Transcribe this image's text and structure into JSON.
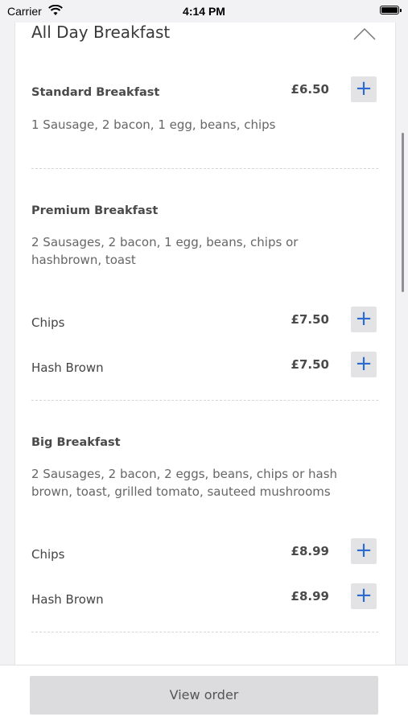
{
  "status_bar": {
    "carrier": "Carrier",
    "time": "4:14 PM"
  },
  "section": {
    "title": "All Day Breakfast"
  },
  "items": [
    {
      "name": "Standard Breakfast",
      "price": "£6.50",
      "description": "1 Sausage, 2 bacon, 1 egg, beans, chips"
    },
    {
      "name": "Premium Breakfast",
      "description": "2 Sausages, 2 bacon, 1 egg, beans, chips or hashbrown, toast",
      "options": [
        {
          "name": "Chips",
          "price": "£7.50"
        },
        {
          "name": "Hash Brown",
          "price": "£7.50"
        }
      ]
    },
    {
      "name": "Big Breakfast",
      "description": "2 Sausages, 2 bacon, 2 eggs, beans, chips or hash brown, toast, grilled tomato, sauteed mushrooms",
      "options": [
        {
          "name": "Chips",
          "price": "£8.99"
        },
        {
          "name": "Hash Brown",
          "price": "£8.99"
        }
      ]
    }
  ],
  "add_symbol": "+",
  "footer": {
    "view_order_label": "View order"
  },
  "colors": {
    "accent": "#2d6bd1",
    "button_bg": "#e3e3e5"
  },
  "icons": {
    "collapse": "chevron-up-icon",
    "wifi": "wifi-icon",
    "battery": "battery-icon"
  }
}
